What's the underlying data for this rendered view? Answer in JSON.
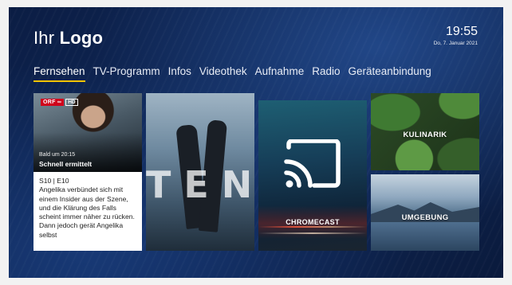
{
  "header": {
    "logo_light": "Ihr",
    "logo_bold": "Logo",
    "time": "19:55",
    "date": "Do, 7. Januar 2021"
  },
  "nav": {
    "items": [
      {
        "label": "Fernsehen",
        "active": true
      },
      {
        "label": "TV-Programm"
      },
      {
        "label": "Infos"
      },
      {
        "label": "Videothek"
      },
      {
        "label": "Aufnahme"
      },
      {
        "label": "Radio"
      },
      {
        "label": "Geräteanbindung"
      }
    ],
    "accent_color": "#f5c400"
  },
  "tiles": {
    "live": {
      "channel": "ORF",
      "channel_suffix": "HD",
      "subtitle": "Bald um 20:15",
      "title": "Schnell ermittelt",
      "episode": "S10 | E10",
      "description": "Angelika verbündet sich mit einem Insider aus der Szene, und die Klärung des Falls scheint immer näher zu rücken. Dann jedoch gerät Angelika selbst"
    },
    "poster": {
      "title": "TENET"
    },
    "chromecast": {
      "label": "CHROMECAST",
      "icon": "cast-icon"
    },
    "kulinarik": {
      "label": "KULINARIK"
    },
    "umgebung": {
      "label": "UMGEBUNG"
    }
  }
}
